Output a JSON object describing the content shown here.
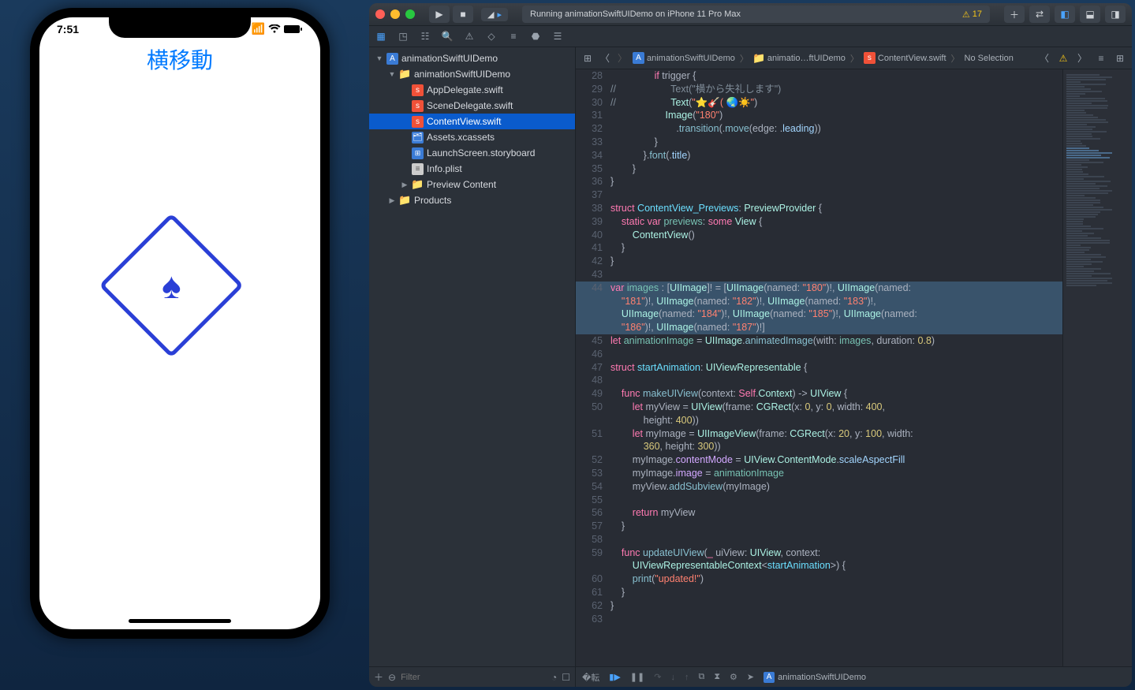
{
  "simulator": {
    "time": "7:51",
    "navTitle": "横移動"
  },
  "xcode": {
    "statusText": "Running animationSwiftUIDemo on iPhone 11 Pro Max",
    "warningCount": "17",
    "schemeTarget": "",
    "filterPlaceholder": "Filter",
    "debugProject": "animationSwiftUIDemo",
    "jumpbar": {
      "proj": "animationSwiftUIDemo",
      "folder": "animatio…ftUIDemo",
      "file": "ContentView.swift",
      "sel": "No Selection"
    },
    "tree": [
      {
        "depth": 0,
        "disc": "▼",
        "icon": "proj",
        "label": "animationSwiftUIDemo"
      },
      {
        "depth": 1,
        "disc": "▼",
        "icon": "folder",
        "label": "animationSwiftUIDemo"
      },
      {
        "depth": 2,
        "disc": "",
        "icon": "swift",
        "label": "AppDelegate.swift"
      },
      {
        "depth": 2,
        "disc": "",
        "icon": "swift",
        "label": "SceneDelegate.swift"
      },
      {
        "depth": 2,
        "disc": "",
        "icon": "swift",
        "label": "ContentView.swift",
        "selected": true
      },
      {
        "depth": 2,
        "disc": "",
        "icon": "assets",
        "label": "Assets.xcassets"
      },
      {
        "depth": 2,
        "disc": "",
        "icon": "story",
        "label": "LaunchScreen.storyboard"
      },
      {
        "depth": 2,
        "disc": "",
        "icon": "plist",
        "label": "Info.plist"
      },
      {
        "depth": 2,
        "disc": "▶",
        "icon": "folder",
        "label": "Preview Content"
      },
      {
        "depth": 1,
        "disc": "▶",
        "icon": "folder",
        "label": "Products"
      }
    ],
    "code": [
      {
        "n": 28,
        "h": 0,
        "html": "                <span class='kw'>if</span> trigger {"
      },
      {
        "n": 29,
        "h": 0,
        "html": "<span class='cm'>//                    Text(\"横から失礼します\")</span>"
      },
      {
        "n": 30,
        "h": 0,
        "html": "<span class='cm'>//                    </span><span class='ty2'>Text</span>(<span class='str'>\"⭐️🎸( 🌏☀️\"</span>)"
      },
      {
        "n": 31,
        "h": 0,
        "html": "                    <span class='ty2'>Image</span>(<span class='str'>\"180\"</span>)"
      },
      {
        "n": 32,
        "h": 0,
        "html": "                        .<span class='fn'>transition</span>(.<span class='fn'>move</span>(edge: .<span class='en'>leading</span>))"
      },
      {
        "n": 33,
        "h": 0,
        "html": "                }"
      },
      {
        "n": 34,
        "h": 0,
        "html": "            }.<span class='fn'>font</span>(.<span class='en'>title</span>)"
      },
      {
        "n": 35,
        "h": 0,
        "html": "        }"
      },
      {
        "n": 36,
        "h": 0,
        "html": "}"
      },
      {
        "n": 37,
        "h": 0,
        "html": ""
      },
      {
        "n": 38,
        "h": 0,
        "html": "<span class='kw'>struct</span> <span class='ty'>ContentView_Previews</span>: <span class='ty2'>PreviewProvider</span> {"
      },
      {
        "n": 39,
        "h": 0,
        "html": "    <span class='kw'>static</span> <span class='kw'>var</span> <span class='id'>previews</span>: <span class='kw'>some</span> <span class='ty2'>View</span> {"
      },
      {
        "n": 40,
        "h": 0,
        "html": "        <span class='ty2'>ContentView</span>()"
      },
      {
        "n": 41,
        "h": 0,
        "html": "    }"
      },
      {
        "n": 42,
        "h": 0,
        "html": "}"
      },
      {
        "n": 43,
        "h": 0,
        "html": ""
      },
      {
        "n": 44,
        "h": 1,
        "html": "<span class='kw'>var</span> <span class='id'>images</span> : [<span class='ty2'>UIImage</span>]! = [<span class='ty2'>UIImage</span>(named: <span class='str'>\"180\"</span>)!, <span class='ty2'>UIImage</span>(named:"
      },
      {
        "n": "",
        "h": 1,
        "html": "    <span class='str'>\"181\"</span>)!, <span class='ty2'>UIImage</span>(named: <span class='str'>\"182\"</span>)!, <span class='ty2'>UIImage</span>(named: <span class='str'>\"183\"</span>)!,"
      },
      {
        "n": "",
        "h": 1,
        "html": "    <span class='ty2'>UIImage</span>(named: <span class='str'>\"184\"</span>)!, <span class='ty2'>UIImage</span>(named: <span class='str'>\"185\"</span>)!, <span class='ty2'>UIImage</span>(named:"
      },
      {
        "n": "",
        "h": 1,
        "html": "    <span class='str'>\"186\"</span>)!, <span class='ty2'>UIImage</span>(named: <span class='str'>\"187\"</span>)!]"
      },
      {
        "n": 45,
        "h": 0,
        "html": "<span class='kw'>let</span> <span class='id'>animationImage</span> = <span class='ty2'>UIImage</span>.<span class='fn'>animatedImage</span>(with: <span class='id'>images</span>, duration: <span class='num'>0.8</span>)"
      },
      {
        "n": 46,
        "h": 0,
        "html": ""
      },
      {
        "n": 47,
        "h": 0,
        "html": "<span class='kw'>struct</span> <span class='ty'>startAnimation</span>: <span class='ty2'>UIViewRepresentable</span> {"
      },
      {
        "n": 48,
        "h": 0,
        "html": ""
      },
      {
        "n": 49,
        "h": 0,
        "html": "    <span class='kw'>func</span> <span class='fn'>makeUIView</span>(context: <span class='kw'>Self</span>.<span class='ty2'>Context</span>) -> <span class='ty2'>UIView</span> {"
      },
      {
        "n": 50,
        "h": 0,
        "html": "        <span class='kw'>let</span> myView = <span class='ty2'>UIView</span>(frame: <span class='ty2'>CGRect</span>(x: <span class='num'>0</span>, y: <span class='num'>0</span>, width: <span class='num'>400</span>,"
      },
      {
        "n": "",
        "h": 0,
        "html": "            height: <span class='num'>400</span>))"
      },
      {
        "n": 51,
        "h": 0,
        "html": "        <span class='kw'>let</span> myImage = <span class='ty2'>UIImageView</span>(frame: <span class='ty2'>CGRect</span>(x: <span class='num'>20</span>, y: <span class='num'>100</span>, width:"
      },
      {
        "n": "",
        "h": 0,
        "html": "            <span class='num'>360</span>, height: <span class='num'>300</span>))"
      },
      {
        "n": 52,
        "h": 0,
        "html": "        myImage.<span class='pr'>contentMode</span> = <span class='ty2'>UIView</span>.<span class='ty2'>ContentMode</span>.<span class='en'>scaleAspectFill</span>"
      },
      {
        "n": 53,
        "h": 0,
        "html": "        myImage.<span class='pr'>image</span> = <span class='id'>animationImage</span>"
      },
      {
        "n": 54,
        "h": 0,
        "html": "        myView.<span class='fn'>addSubview</span>(myImage)"
      },
      {
        "n": 55,
        "h": 0,
        "html": ""
      },
      {
        "n": 56,
        "h": 0,
        "html": "        <span class='kw'>return</span> myView"
      },
      {
        "n": 57,
        "h": 0,
        "html": "    }"
      },
      {
        "n": 58,
        "h": 0,
        "html": ""
      },
      {
        "n": 59,
        "h": 0,
        "html": "    <span class='kw'>func</span> <span class='fn'>updateUIView</span>(<span class='kw'>_</span> uiView: <span class='ty2'>UIView</span>, context:"
      },
      {
        "n": "",
        "h": 0,
        "html": "        <span class='ty2'>UIViewRepresentableContext</span>&lt;<span class='ty'>startAnimation</span>&gt;) {"
      },
      {
        "n": 60,
        "h": 0,
        "html": "        <span class='fn'>print</span>(<span class='str'>\"updated!\"</span>)"
      },
      {
        "n": 61,
        "h": 0,
        "html": "    }"
      },
      {
        "n": 62,
        "h": 0,
        "html": "}"
      },
      {
        "n": 63,
        "h": 0,
        "html": ""
      }
    ]
  }
}
